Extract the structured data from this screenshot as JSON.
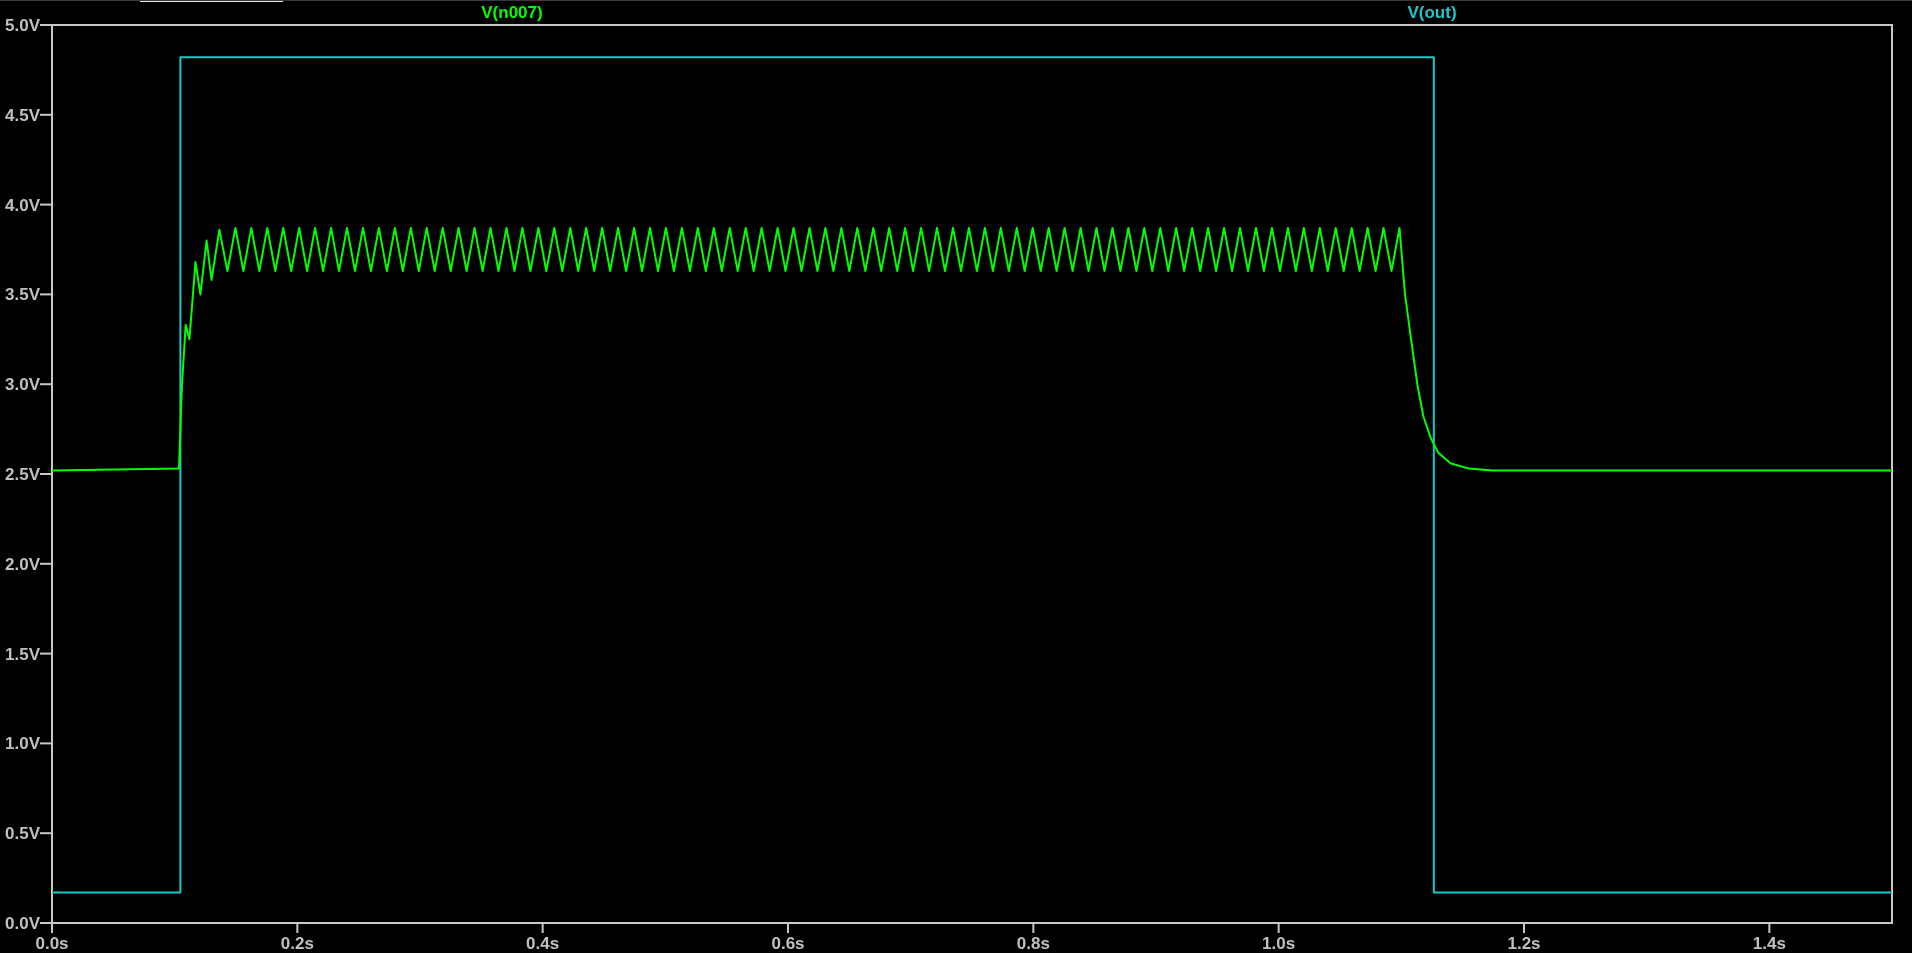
{
  "plot": {
    "chart_data": {
      "type": "line",
      "xlim": [
        0,
        1.5
      ],
      "ylim": [
        0,
        5
      ],
      "xticks": [
        {
          "value": 0,
          "label": "0.0s"
        },
        {
          "value": 0.2,
          "label": "0.2s"
        },
        {
          "value": 0.4,
          "label": "0.4s"
        },
        {
          "value": 0.6,
          "label": "0.6s"
        },
        {
          "value": 0.8,
          "label": "0.8s"
        },
        {
          "value": 1.0,
          "label": "1.0s"
        },
        {
          "value": 1.2,
          "label": "1.2s"
        },
        {
          "value": 1.4,
          "label": "1.4s"
        }
      ],
      "yticks": [
        {
          "value": 0,
          "label": "0.0V"
        },
        {
          "value": 0.5,
          "label": "0.5V"
        },
        {
          "value": 1,
          "label": "1.0V"
        },
        {
          "value": 1.5,
          "label": "1.5V"
        },
        {
          "value": 2,
          "label": "2.0V"
        },
        {
          "value": 2.5,
          "label": "2.5V"
        },
        {
          "value": 3,
          "label": "3.0V"
        },
        {
          "value": 3.5,
          "label": "3.5V"
        },
        {
          "value": 4,
          "label": "4.0V"
        },
        {
          "value": 4.5,
          "label": "4.5V"
        },
        {
          "value": 5,
          "label": "5.0V"
        }
      ],
      "series": [
        {
          "name": "V(n007)",
          "color": "#00ff00",
          "x": [
            0,
            0.1035,
            0.106,
            0.109,
            0.112,
            0.117,
            0.121,
            0.126,
            0.13,
            0.1365,
            0.143,
            0.1495,
            0.156,
            0.1625,
            0.169,
            0.1755,
            0.182,
            0.1885,
            0.195,
            0.2015,
            0.208,
            0.2145,
            0.221,
            0.2275,
            0.234,
            0.2405,
            0.247,
            0.2535,
            0.26,
            0.2665,
            0.273,
            0.2795,
            0.286,
            0.2925,
            0.299,
            0.3055,
            0.312,
            0.3185,
            0.325,
            0.3315,
            0.338,
            0.3445,
            0.351,
            0.3575,
            0.364,
            0.3705,
            0.377,
            0.3835,
            0.39,
            0.3965,
            0.403,
            0.4095,
            0.416,
            0.4225,
            0.429,
            0.4355,
            0.442,
            0.4485,
            0.455,
            0.4615,
            0.468,
            0.4745,
            0.481,
            0.4875,
            0.494,
            0.5005,
            0.507,
            0.5135,
            0.52,
            0.5265,
            0.533,
            0.5395,
            0.546,
            0.5525,
            0.559,
            0.5655,
            0.572,
            0.5785,
            0.585,
            0.5915,
            0.598,
            0.6045,
            0.611,
            0.6175,
            0.624,
            0.6305,
            0.637,
            0.6435,
            0.65,
            0.6565,
            0.663,
            0.6695,
            0.676,
            0.6825,
            0.689,
            0.6955,
            0.702,
            0.7085,
            0.715,
            0.7215,
            0.728,
            0.7345,
            0.741,
            0.7475,
            0.754,
            0.7605,
            0.767,
            0.7735,
            0.78,
            0.7865,
            0.793,
            0.7995,
            0.806,
            0.8125,
            0.819,
            0.8255,
            0.832,
            0.8385,
            0.845,
            0.8515,
            0.858,
            0.8645,
            0.871,
            0.8775,
            0.884,
            0.8905,
            0.897,
            0.9035,
            0.91,
            0.9165,
            0.923,
            0.9295,
            0.936,
            0.9425,
            0.949,
            0.9555,
            0.962,
            0.9685,
            0.975,
            0.9815,
            0.988,
            0.9945,
            1.001,
            1.0075,
            1.014,
            1.0205,
            1.027,
            1.0335,
            1.04,
            1.0465,
            1.053,
            1.0595,
            1.066,
            1.0725,
            1.079,
            1.0855,
            1.092,
            1.0985,
            1.103,
            1.108,
            1.113,
            1.118,
            1.124,
            1.13,
            1.14,
            1.155,
            1.175,
            1.5
          ],
          "values": [
            2.52,
            2.53,
            3.0,
            3.33,
            3.25,
            3.68,
            3.5,
            3.8,
            3.58,
            3.86,
            3.63,
            3.87,
            3.63,
            3.87,
            3.63,
            3.87,
            3.63,
            3.87,
            3.63,
            3.87,
            3.63,
            3.87,
            3.63,
            3.87,
            3.63,
            3.87,
            3.63,
            3.87,
            3.63,
            3.87,
            3.63,
            3.87,
            3.63,
            3.87,
            3.63,
            3.87,
            3.63,
            3.87,
            3.63,
            3.87,
            3.63,
            3.87,
            3.63,
            3.87,
            3.63,
            3.87,
            3.63,
            3.87,
            3.63,
            3.87,
            3.63,
            3.87,
            3.63,
            3.87,
            3.63,
            3.87,
            3.63,
            3.87,
            3.63,
            3.87,
            3.63,
            3.87,
            3.63,
            3.87,
            3.63,
            3.87,
            3.63,
            3.87,
            3.63,
            3.87,
            3.63,
            3.87,
            3.63,
            3.87,
            3.63,
            3.87,
            3.63,
            3.87,
            3.63,
            3.87,
            3.63,
            3.87,
            3.63,
            3.87,
            3.63,
            3.87,
            3.63,
            3.87,
            3.63,
            3.87,
            3.63,
            3.87,
            3.63,
            3.87,
            3.63,
            3.87,
            3.63,
            3.87,
            3.63,
            3.87,
            3.63,
            3.87,
            3.63,
            3.87,
            3.63,
            3.87,
            3.63,
            3.87,
            3.63,
            3.87,
            3.63,
            3.87,
            3.63,
            3.87,
            3.63,
            3.87,
            3.63,
            3.87,
            3.63,
            3.87,
            3.63,
            3.87,
            3.63,
            3.87,
            3.63,
            3.87,
            3.63,
            3.87,
            3.63,
            3.87,
            3.63,
            3.87,
            3.63,
            3.87,
            3.63,
            3.87,
            3.63,
            3.87,
            3.63,
            3.87,
            3.63,
            3.87,
            3.63,
            3.87,
            3.63,
            3.87,
            3.63,
            3.87,
            3.63,
            3.87,
            3.63,
            3.87,
            3.63,
            3.87,
            3.63,
            3.87,
            3.63,
            3.87,
            3.5,
            3.25,
            3.0,
            2.82,
            2.7,
            2.62,
            2.56,
            2.53,
            2.52,
            2.52
          ]
        },
        {
          "name": "V(out)",
          "color": "#1fc8c8",
          "x": [
            0,
            0.1047,
            0.1047,
            1.1265,
            1.1265,
            1.5
          ],
          "values": [
            0.17,
            0.17,
            4.82,
            4.82,
            0.17,
            0.17
          ]
        }
      ]
    }
  }
}
